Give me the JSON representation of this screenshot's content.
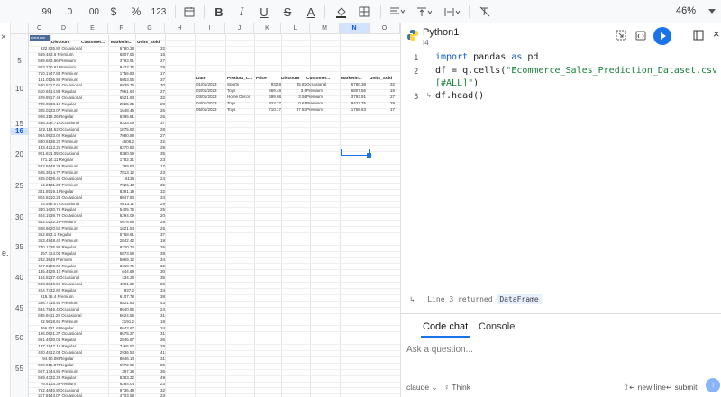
{
  "toolbar": {
    "decimal_places": "99",
    "decrease_decimal": ".0",
    "increase_decimal": ".00",
    "currency": "$",
    "percent": "%",
    "number_format": "123",
    "bold": "B",
    "italic": "I",
    "underline": "U",
    "strikethrough": "S",
    "text_color": "A",
    "zoom": "46%"
  },
  "sheet": {
    "columns": [
      "C",
      "D",
      "E",
      "F",
      "G",
      "H",
      "I",
      "J",
      "K",
      "L",
      "M",
      "N",
      "O"
    ],
    "selected_column": "N",
    "selected_row": "16",
    "row_labels": [
      "5",
      "10",
      "15",
      "16",
      "20",
      "25",
      "30",
      "35",
      "40",
      "45",
      "50",
      "55"
    ],
    "tag": "ment.csv",
    "left_headers": [
      "Discount",
      "Customer...",
      "Marketin...",
      "Units_Sold"
    ],
    "left_rows": [
      [
        "932.8",
        "35.82 Occasional",
        "6780.38",
        "32"
      ],
      [
        "569.48",
        "3.6 Premium",
        "6807.56",
        "16"
      ],
      [
        "699.68",
        "3.56 Premium",
        "3793.91",
        "27"
      ],
      [
        "923.27",
        "0.61 Premium",
        "9422.75",
        "29"
      ],
      [
        "710.17",
        "47.83 Premium",
        "1756.83",
        "17"
      ],
      [
        "161.01",
        "36.88 Premium",
        "5053.56",
        "37"
      ],
      [
        "580.53",
        "17.66 Occasional",
        "6939.75",
        "30"
      ],
      [
        "610.65",
        "14.83 Regular",
        "7061.64",
        "27"
      ],
      [
        "429.89",
        "17.49 Occasional",
        "6521.53",
        "32"
      ],
      [
        "739.08",
        "38.19 Regular",
        "2825.35",
        "28"
      ],
      [
        "305.02",
        "33.07 Premium",
        "1648.45",
        "26"
      ],
      [
        "928.31",
        "9.26 Regular",
        "6395.81",
        "26"
      ],
      [
        "456.33",
        "8.71 Occasional",
        "6333.09",
        "37"
      ],
      [
        "122.11",
        "4.52 Occasional",
        "1875.62",
        "28"
      ],
      [
        "984.99",
        "33.02 Regular",
        "7080.88",
        "27"
      ],
      [
        "840.51",
        "38.22 Premium",
        "4606.2",
        "32"
      ],
      [
        "133.42",
        "13.25 Premium",
        "6270.83",
        "29"
      ],
      [
        "921.63",
        "1.05 Occasional",
        "8380.59",
        "35"
      ],
      [
        "871.2",
        "4.11 Regular",
        "1782.31",
        "23"
      ],
      [
        "523.65",
        "48.39 Premium",
        "289.53",
        "17"
      ],
      [
        "595.36",
        "14.77 Premium",
        "7813.12",
        "23"
      ],
      [
        "405.01",
        "39.46 Occasional",
        "6136",
        "24"
      ],
      [
        "64.21",
        "31.23 Premium",
        "7026.43",
        "35"
      ],
      [
        "341.85",
        "19.1 Regular",
        "8391.19",
        "32"
      ],
      [
        "804.82",
        "10.28 Occasional",
        "8047.83",
        "34"
      ],
      [
        "14.59",
        "6.07 Occasional",
        "9613.11",
        "29"
      ],
      [
        "340.16",
        "30.75 Regular",
        "5405.76",
        "25"
      ],
      [
        "404.19",
        "39.79 Occasional",
        "6294.09",
        "20"
      ],
      [
        "542.02",
        "32.2 Premium",
        "4078.68",
        "29"
      ],
      [
        "928.66",
        "20.52 Premium",
        "1621.54",
        "25"
      ],
      [
        "352.88",
        "3.1 Regular",
        "5768.81",
        "37"
      ],
      [
        "353.48",
        "48.42 Premium",
        "2842.42",
        "19"
      ],
      [
        "740.13",
        "35.94 Regular",
        "9220.74",
        "26"
      ],
      [
        "457.7",
        "14.04 Regular",
        "5873.59",
        "39"
      ],
      [
        "232.36",
        "49 Premium",
        "5069.12",
        "34"
      ],
      [
        "497.92",
        "20.09 Regular",
        "3610.75",
        "32"
      ],
      [
        "145.45",
        "29.12 Premium",
        "644.69",
        "30"
      ],
      [
        "184.62",
        "37.4 Occasional",
        "434.26",
        "35"
      ],
      [
        "503.38",
        "40.59 Occasional",
        "4291.02",
        "29"
      ],
      [
        "424.74",
        "32.82 Regular",
        "937.2",
        "34"
      ],
      [
        "915.7",
        "6.4 Premium",
        "6107.78",
        "38"
      ],
      [
        "368.77",
        "16.91 Premium",
        "8821.63",
        "43"
      ],
      [
        "584.78",
        "46.4 Occasional",
        "8640.86",
        "24"
      ],
      [
        "635.94",
        "11.29 Occasional",
        "6624.55",
        "31"
      ],
      [
        "22.96",
        "18.61 Premium",
        "2191.2",
        "18"
      ],
      [
        "466.9",
        "21.6 Regular",
        "8643.67",
        "34"
      ],
      [
        "196.06",
        "21.37 Occasional",
        "8675.27",
        "31"
      ],
      [
        "961.46",
        "30.05 Regular",
        "2846.87",
        "36"
      ],
      [
        "137.18",
        "47.15 Regular",
        "7466.52",
        "29"
      ],
      [
        "420.48",
        "12.03 Occasional",
        "2936.54",
        "41"
      ],
      [
        "94.5",
        "0.08 Regular",
        "8046.14",
        "31"
      ],
      [
        "996.91",
        "5.87 Regular",
        "9972.66",
        "25"
      ],
      [
        "507.17",
        "44.85 Premium",
        "397.28",
        "36"
      ],
      [
        "599.43",
        "32.29 Regular",
        "8383.32",
        "49"
      ],
      [
        "76.41",
        "14.3 Premium",
        "6264.04",
        "23"
      ],
      [
        "752.46",
        "40.8 Occasional",
        "9736.49",
        "32"
      ],
      [
        "217.81",
        "43.07 Occasional",
        "4703.59",
        "23"
      ]
    ],
    "right_headers": [
      "Date",
      "Product_C...",
      "Price",
      "Discount",
      "Customer...",
      "Marketin...",
      "Units_Sold"
    ],
    "right_rows": [
      [
        "01/01/2023",
        "Sports",
        "932.8",
        "35.82",
        "Occasional",
        "6780.38",
        "32"
      ],
      [
        "02/01/2023",
        "Toys",
        "569.48",
        "3.6",
        "Premium",
        "6807.56",
        "16"
      ],
      [
        "03/01/2023",
        "Home Decor",
        "699.68",
        "3.56",
        "Premium",
        "3793.91",
        "27"
      ],
      [
        "04/01/2023",
        "Toys",
        "923.27",
        "0.61",
        "Premium",
        "9422.75",
        "29"
      ],
      [
        "05/01/2023",
        "Toys",
        "710.17",
        "47.83",
        "Premium",
        "1756.83",
        "17"
      ]
    ]
  },
  "python": {
    "title": "Python1",
    "subtitle": "I4",
    "code": [
      {
        "num": "1",
        "pre": "import",
        "mid": " pandas ",
        "kw2": "as",
        "post": " pd"
      },
      {
        "num": "2",
        "text": "df = q.cells(",
        "str": "\"Ecommerce_Sales_Prediction_Dataset.csv"
      },
      {
        "num": "",
        "str": "[#ALL]\"",
        "text": ")"
      },
      {
        "num": "3",
        "text": "df.head()"
      }
    ],
    "status_prefix": "Line 3 returned",
    "status_type": "DataFrame",
    "tabs": [
      "Code chat",
      "Console"
    ],
    "ask_placeholder": "Ask a question...",
    "model": "claude",
    "think": "Think",
    "new_line": "new line",
    "submit": "submit"
  }
}
